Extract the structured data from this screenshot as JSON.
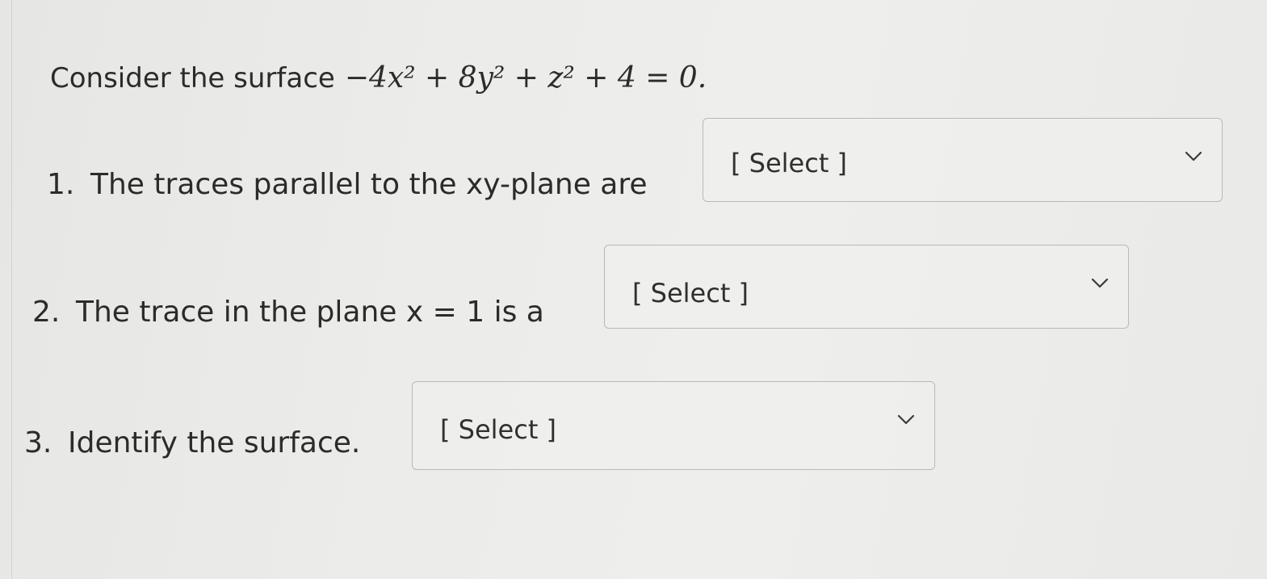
{
  "intro": {
    "text": "Consider the surface",
    "equation": "−4x² + 8y² + z² + 4 = 0."
  },
  "questions": [
    {
      "number": "1.",
      "prompt": "The traces parallel to the xy-plane are",
      "select_value": "[ Select ]",
      "chevron_icon": "chevron-down-icon"
    },
    {
      "number": "2.",
      "prompt": "The trace in the plane x = 1 is a",
      "select_value": "[ Select ]",
      "chevron_icon": "chevron-down-icon"
    },
    {
      "number": "3.",
      "prompt": "Identify the surface.",
      "select_value": "[ Select ]",
      "chevron_icon": "chevron-down-icon"
    }
  ],
  "colors": {
    "text": "#2b2b2b",
    "border": "#b9b9b7",
    "background": "#ececea"
  }
}
